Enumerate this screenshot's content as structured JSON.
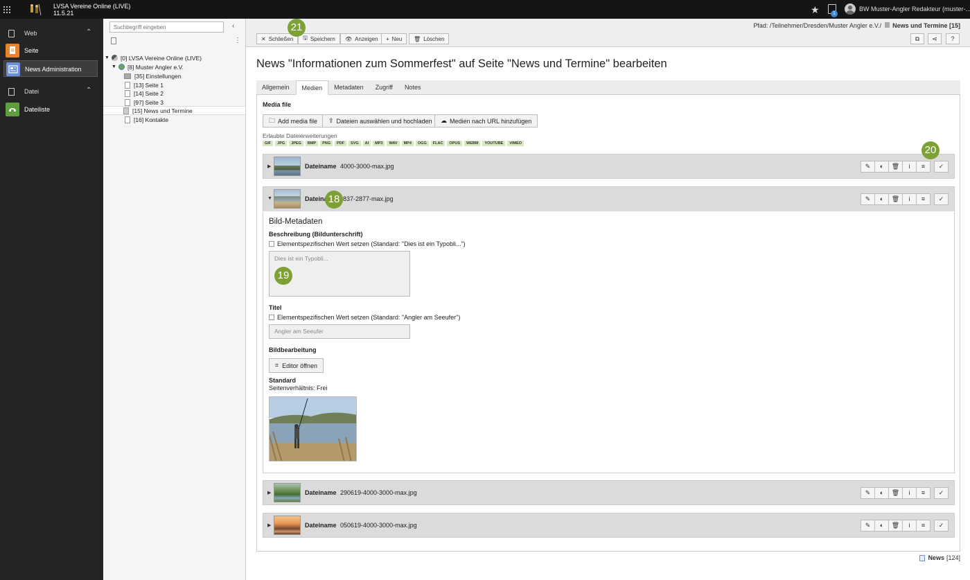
{
  "app": {
    "title": "LVSA Vereine Online (LIVE)",
    "version": "11.5.21",
    "user": "BW Muster-Angler Redakteur (muster-...",
    "notification_count": "1"
  },
  "sidebar": {
    "web_label": "Web",
    "items_web": [
      {
        "label": "Seite"
      },
      {
        "label": "News Administration"
      }
    ],
    "datei_label": "Datei",
    "items_datei": [
      {
        "label": "Dateiliste"
      }
    ]
  },
  "tree": {
    "search_placeholder": "Suchbegriff eingeben",
    "nodes": [
      "[0] LVSA Vereine Online (LIVE)",
      "[8] Muster Angler e.V.",
      "[35] Einstellungen",
      "[13] Seite 1",
      "[14] Seite 2",
      "[97] Seite 3",
      "[15] News und Termine",
      "[16] Kontakte"
    ]
  },
  "docheader": {
    "path_prefix": "Pfad: /Teilnehmer/Dresden/Muster Angler e.V./",
    "path_current": "News und Termine [15]",
    "buttons": {
      "close": "Schließen",
      "save": "Speichern",
      "view": "Anzeigen",
      "new": "Neu",
      "delete": "Löschen"
    }
  },
  "heading": "News \"Informationen zum Sommerfest\" auf Seite \"News und Termine\" bearbeiten",
  "tabs": [
    "Allgemein",
    "Medien",
    "Metadaten",
    "Zugriff",
    "Notes"
  ],
  "media": {
    "section_title": "Media file",
    "btn_add": "Add media file",
    "btn_upload": "Dateien auswählen und hochladen",
    "btn_url": "Medien nach URL hinzufügen",
    "allowed_label": "Erlaubte Dateierweiterungen",
    "extensions": [
      "GIF",
      "JPG",
      "JPEG",
      "BMP",
      "PNG",
      "PDF",
      "SVG",
      "AI",
      "MP3",
      "WAV",
      "MP4",
      "OGG",
      "FLAC",
      "OPUS",
      "WEBM",
      "YOUTUBE",
      "VIMEO"
    ],
    "filename_label": "Dateiname",
    "files": [
      "4000-3000-max.jpg",
      "837-2877-max.jpg",
      "290619-4000-3000-max.jpg",
      "050619-4000-3000-max.jpg"
    ]
  },
  "meta": {
    "title": "Bild-Metadaten",
    "desc_label": "Beschreibung (Bildunterschrift)",
    "desc_checkbox": "Elementspezifischen Wert setzen (Standard: \"Dies ist ein Typobli...\")",
    "desc_placeholder": "Dies ist ein Typobli...",
    "titel_label": "Titel",
    "titel_checkbox": "Elementspezifischen Wert setzen (Standard: \"Angler am Seeufer\")",
    "titel_placeholder": "Angler am Seeufer",
    "edit_label": "Bildbearbeitung",
    "edit_button": "Editor öffnen",
    "crop_label": "Standard",
    "ratio": "Seitenverhältnis: Frei"
  },
  "markers": {
    "m18": "18",
    "m19": "19",
    "m20": "20",
    "m21": "21"
  },
  "footer": {
    "record_type": "News",
    "record_id": "[124]"
  },
  "colors": {
    "topbar": "#151515",
    "sidebar": "#242424",
    "marker": "#7da135",
    "seite_icon": "#e8822b",
    "news_icon": "#6c8fd6",
    "datei_icon": "#5f9d3f"
  }
}
